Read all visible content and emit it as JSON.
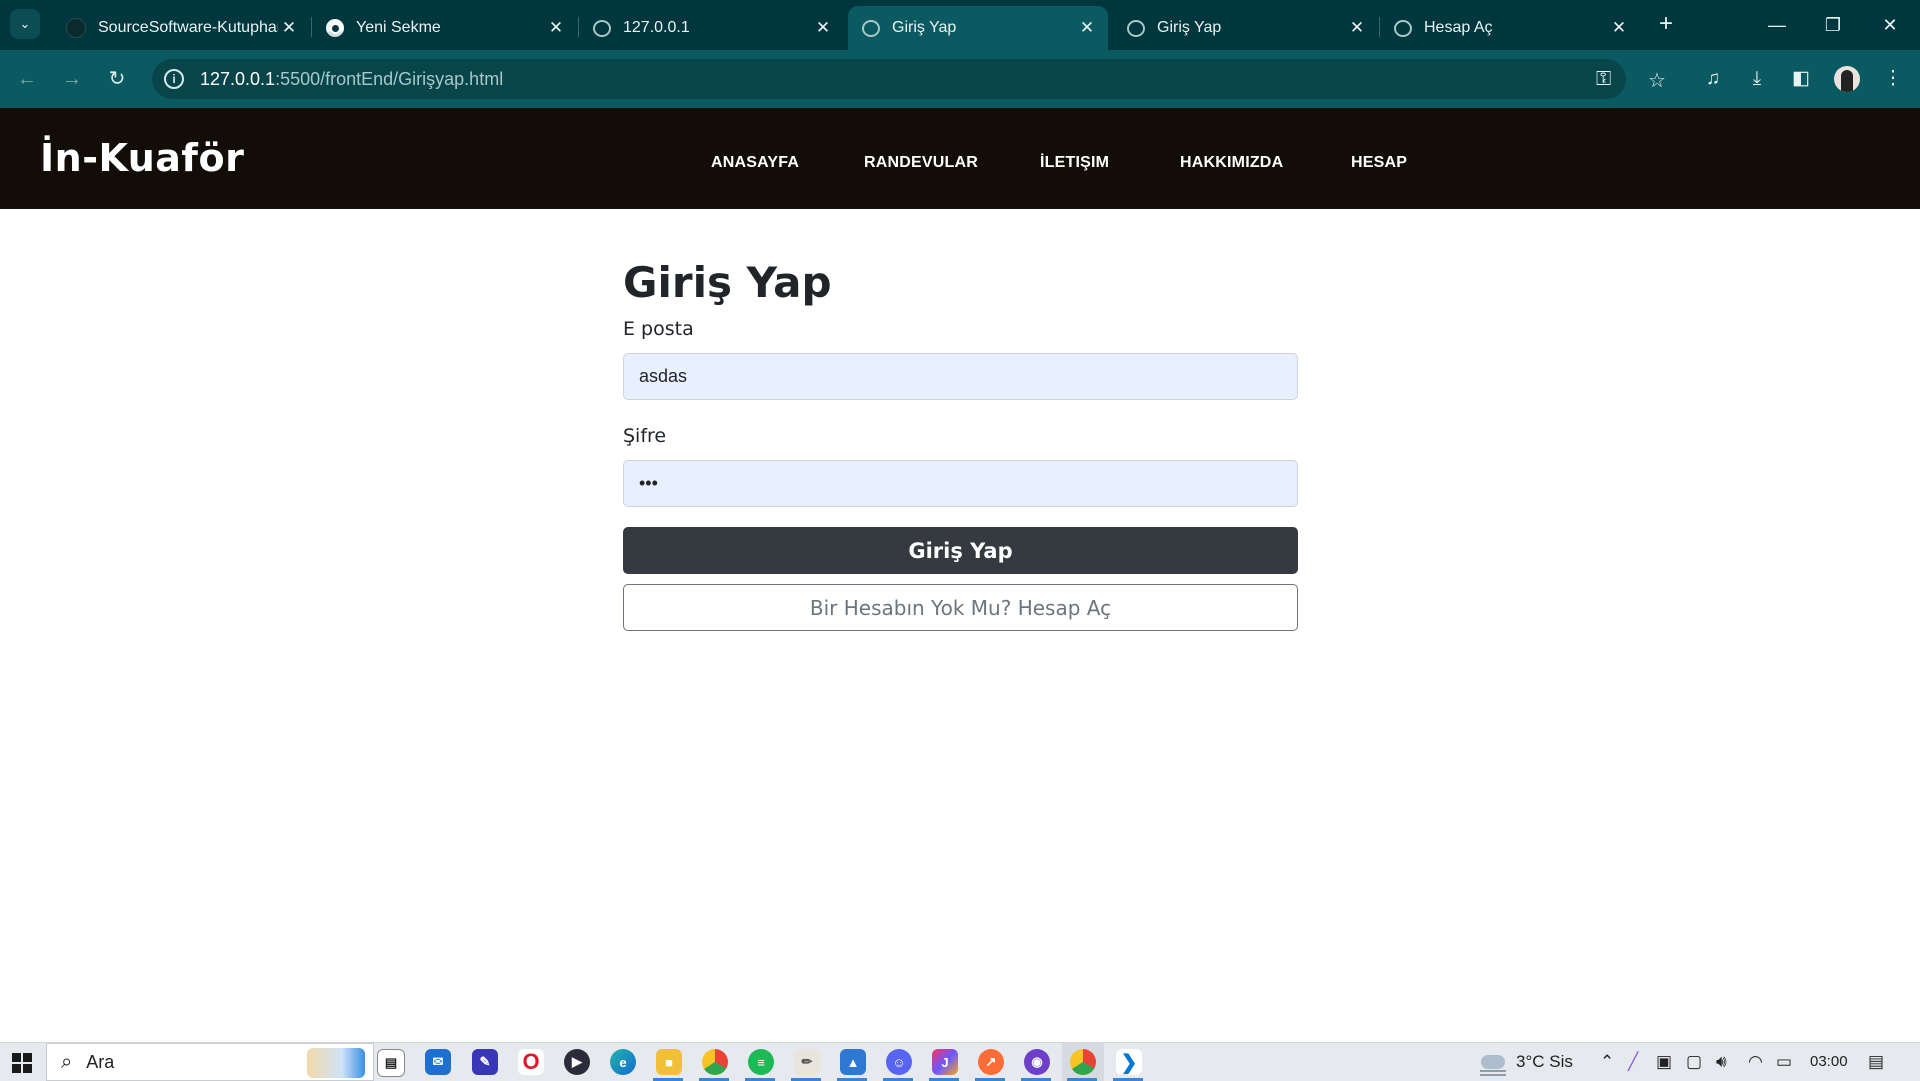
{
  "browser": {
    "tabs": [
      {
        "title": "SourceSoftware-Kutuphane",
        "favicon": "github-icon",
        "active": false
      },
      {
        "title": "Yeni Sekme",
        "favicon": "chrome-icon",
        "active": false
      },
      {
        "title": "127.0.0.1",
        "favicon": "globe-icon",
        "active": false
      },
      {
        "title": "Giriş Yap",
        "favicon": "globe-icon",
        "active": true
      },
      {
        "title": "Giriş Yap",
        "favicon": "globe-icon",
        "active": false
      },
      {
        "title": "Hesap Aç",
        "favicon": "globe-icon",
        "active": false
      }
    ],
    "url_host": "127.0.0.1",
    "url_path": ":5500/frontEnd/Girişyap.html"
  },
  "site": {
    "brand": "İn-Kuaför",
    "nav": [
      "ANASAYFA",
      "RANDEVULAR",
      "İLETIŞIM",
      "HAKKIMIZDA",
      "HESAP"
    ],
    "header_bg": "#130d08"
  },
  "login": {
    "title": "Giriş Yap",
    "email_label": "E posta",
    "email_value": "asdas",
    "password_label": "Şifre",
    "password_value": "•••",
    "submit_label": "Giriş Yap",
    "register_label": "Bir Hesabın Yok Mu? Hesap Aç",
    "submit_color": "#343a40",
    "field_autofill_color": "#e8f0fe"
  },
  "taskbar": {
    "search_placeholder": "Ara",
    "weather": "3°C  Sis",
    "time": "03:00",
    "apps": [
      "task-view-icon",
      "mail-icon",
      "pen-app-icon",
      "opera-icon",
      "media-player-icon",
      "edge-icon",
      "file-explorer-icon",
      "chrome-icon",
      "spotify-icon",
      "paint-icon",
      "photos-icon",
      "discord-icon",
      "jetbrains-icon",
      "postman-icon",
      "github-desktop-icon",
      "chrome-profile-icon",
      "vscode-icon"
    ]
  }
}
